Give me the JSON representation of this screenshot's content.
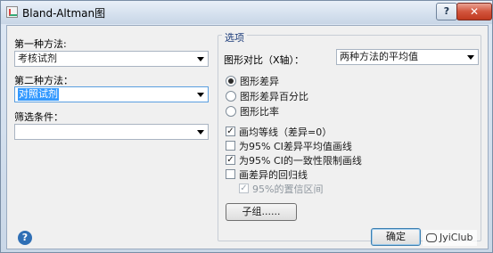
{
  "window": {
    "title": "Bland-Altman图",
    "help_label": "?",
    "close_label": "✕"
  },
  "left": {
    "method1_label": "第一种方法:",
    "method1_value": "考核试剂",
    "method2_label": "第二种方法：",
    "method2_value": "对照试剂",
    "filter_label": "筛选条件：",
    "filter_value": ""
  },
  "options": {
    "group_title": "选项",
    "xaxis_label": "图形对比（X轴）：",
    "xaxis_value": "两种方法的平均值",
    "radios": [
      {
        "label": "图形差异",
        "checked": true
      },
      {
        "label": "图形差异百分比",
        "checked": false
      },
      {
        "label": "图形比率",
        "checked": false
      }
    ],
    "checks": [
      {
        "label": "画均等线（差异=0）",
        "checked": true,
        "disabled": false
      },
      {
        "label": "为95% CI差异平均值画线",
        "checked": false,
        "disabled": false
      },
      {
        "label": "为95% CI的一致性限制画线",
        "checked": true,
        "disabled": false
      },
      {
        "label": "画差异的回归线",
        "checked": false,
        "disabled": false
      },
      {
        "label": "95%的置信区间",
        "checked": true,
        "disabled": true
      }
    ],
    "subgroup_button": "子组......"
  },
  "footer": {
    "ok_button": "确定",
    "help_icon": "?",
    "watermark_text": "JyiClub"
  },
  "icons": {
    "app": "chart-icon",
    "help": "help-icon",
    "close": "close-icon",
    "dropdown": "chevron-down-icon"
  }
}
